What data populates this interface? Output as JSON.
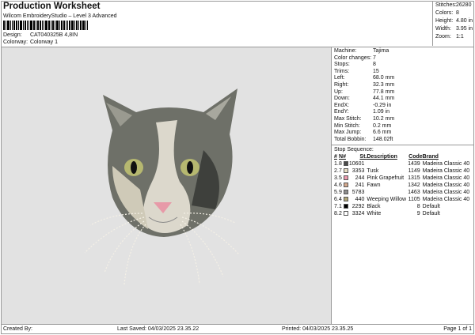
{
  "header": {
    "title": "Production Worksheet",
    "subtitle": "Wilcom EmbroideryStudio – Level 3 Advanced",
    "design_label": "Design:",
    "design_value": "CAT040325B 4,8IN",
    "colorway_label": "Colorway:",
    "colorway_value": "Colorway 1"
  },
  "stats": [
    {
      "label": "Stitches:",
      "value": "26280"
    },
    {
      "label": "Colors:",
      "value": "8"
    },
    {
      "label": "Height:",
      "value": "4.80 in"
    },
    {
      "label": "Width:",
      "value": "3.95 in"
    },
    {
      "label": "Zoom:",
      "value": "1:1"
    }
  ],
  "info": [
    {
      "label": "Machine:",
      "value": "Tajima"
    },
    {
      "label": "Color changes:",
      "value": "7"
    },
    {
      "label": "Stops:",
      "value": "8"
    },
    {
      "label": "Trims:",
      "value": "15"
    },
    {
      "label": "Left:",
      "value": "68.0 mm"
    },
    {
      "label": "Right:",
      "value": "32.3 mm"
    },
    {
      "label": "Up:",
      "value": "77.8 mm"
    },
    {
      "label": "Down:",
      "value": "44.1 mm"
    },
    {
      "label": "EndX:",
      "value": "-0.29 in"
    },
    {
      "label": "EndY:",
      "value": "1.09 in"
    },
    {
      "label": "Max Stitch:",
      "value": "10.2 mm"
    },
    {
      "label": "Min Stitch:",
      "value": "0.2 mm"
    },
    {
      "label": "Max Jump:",
      "value": "6.6 mm"
    },
    {
      "label": "Total Bobbin:",
      "value": "148.02ft"
    }
  ],
  "sequence": {
    "title": "Stop Sequence:",
    "headers": [
      "#",
      "N#",
      "St.",
      "Description",
      "Code",
      "Brand"
    ],
    "rows": [
      {
        "n": "1.",
        "needle": "8",
        "color": "#4a4a4a",
        "st": "10601",
        "desc": "",
        "code": "1439",
        "brand": "Madeira Classic 40"
      },
      {
        "n": "2.",
        "needle": "7",
        "color": "#e6dcc2",
        "st": "3353",
        "desc": "Tusk",
        "code": "1149",
        "brand": "Madeira Classic 40"
      },
      {
        "n": "3.",
        "needle": "5",
        "color": "#ee9aae",
        "st": "244",
        "desc": "Pink Grapefruit",
        "code": "1315",
        "brand": "Madeira Classic 40"
      },
      {
        "n": "4.",
        "needle": "6",
        "color": "#d4a88c",
        "st": "241",
        "desc": "Fawn",
        "code": "1342",
        "brand": "Madeira Classic 40"
      },
      {
        "n": "5.",
        "needle": "9",
        "color": "#8e8e8e",
        "st": "5783",
        "desc": "",
        "code": "1463",
        "brand": "Madeira Classic 40"
      },
      {
        "n": "6.",
        "needle": "4",
        "color": "#b0a678",
        "st": "440",
        "desc": "Weeping Willow",
        "code": "1105",
        "brand": "Madeira Classic 40"
      },
      {
        "n": "7.",
        "needle": "1",
        "color": "#000000",
        "st": "2292",
        "desc": "Black",
        "code": "8",
        "brand": "Default"
      },
      {
        "n": "8.",
        "needle": "2",
        "color": "#ffffff",
        "st": "3324",
        "desc": "White",
        "code": "9",
        "brand": "Default"
      }
    ]
  },
  "footer": {
    "created": "Created By:",
    "saved": "Last Saved: 04/03/2025 23.35.22",
    "printed": "Printed: 04/03/2025 23.35.25",
    "page": "Page 1 of 1"
  }
}
